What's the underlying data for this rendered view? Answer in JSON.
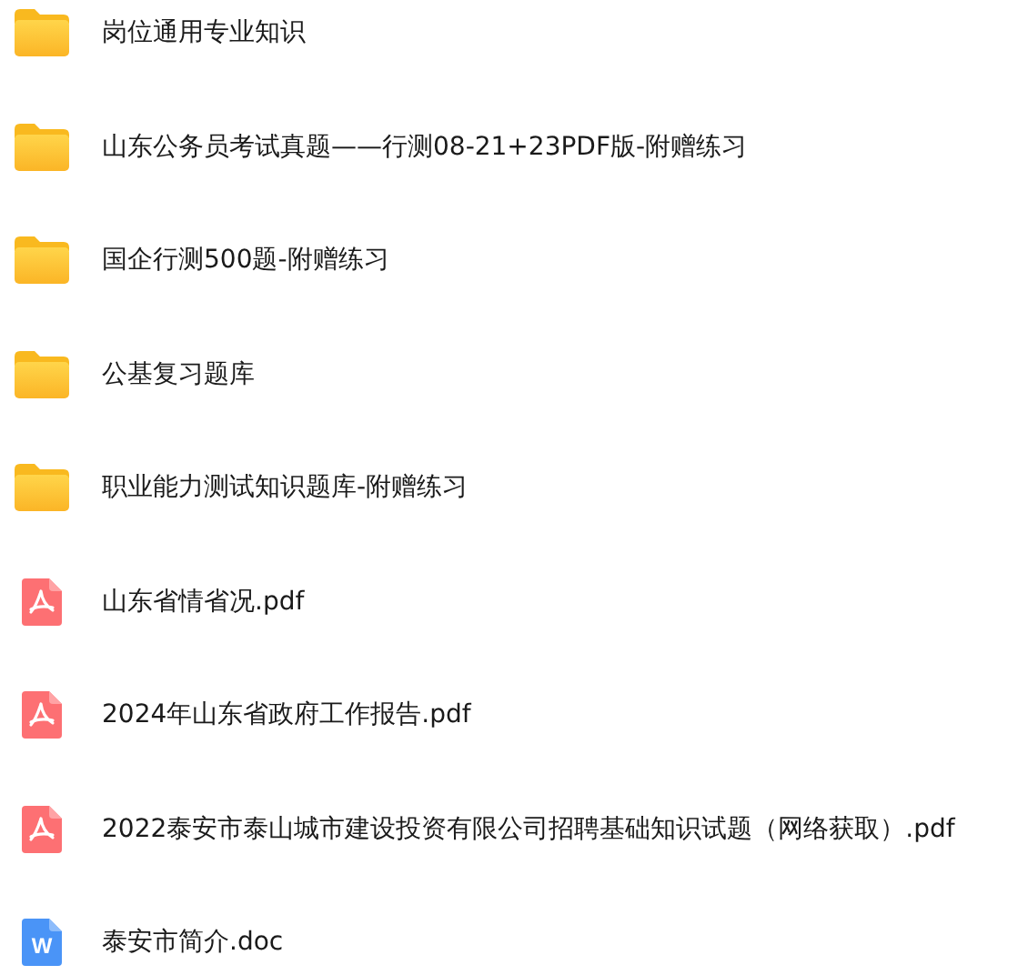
{
  "files": [
    {
      "kind": "folder",
      "name": "岗位通用专业知识"
    },
    {
      "kind": "folder",
      "name": "山东公务员考试真题——行测08-21+23PDF版-附赠练习"
    },
    {
      "kind": "folder",
      "name": "国企行测500题-附赠练习"
    },
    {
      "kind": "folder",
      "name": "公基复习题库"
    },
    {
      "kind": "folder",
      "name": "职业能力测试知识题库-附赠练习"
    },
    {
      "kind": "pdf",
      "name": "山东省情省况.pdf"
    },
    {
      "kind": "pdf",
      "name": "2024年山东省政府工作报告.pdf"
    },
    {
      "kind": "pdf",
      "name": "2022泰安市泰山城市建设投资有限公司招聘基础知识试题（网络获取）.pdf"
    },
    {
      "kind": "doc",
      "name": "泰安市简介.doc",
      "icon_letter": "W"
    }
  ]
}
